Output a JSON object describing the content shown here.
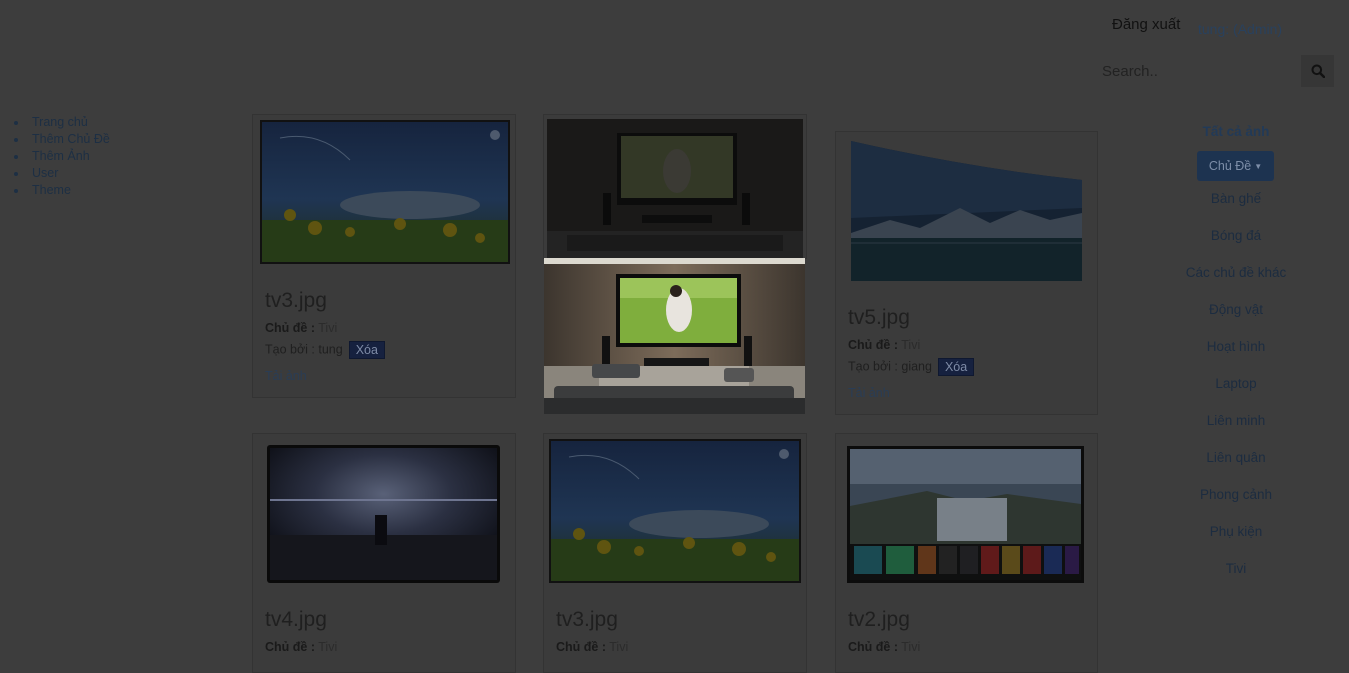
{
  "header": {
    "logout": "Đăng xuất",
    "user": "tung: (Admin)",
    "search_placeholder": "Search..",
    "search_icon": "search-icon"
  },
  "nav": {
    "items": [
      "Trang chủ",
      "Thêm Chủ Đề",
      "Thêm Ảnh",
      "User",
      "Theme"
    ]
  },
  "labels": {
    "topic": "Chủ đề :",
    "created_by": "Tạo bởi :",
    "delete": "Xóa",
    "download": "Tải ảnh"
  },
  "cards": [
    {
      "title": "tv3.jpg",
      "topic": "Tivi",
      "creator": "tung"
    },
    {
      "title": "",
      "topic": "",
      "creator": ""
    },
    {
      "title": "tv5.jpg",
      "topic": "Tivi",
      "creator": "giang"
    },
    {
      "title": "tv4.jpg",
      "topic": "Tivi"
    },
    {
      "title": "tv3.jpg",
      "topic": "Tivi"
    },
    {
      "title": "tv2.jpg",
      "topic": "Tivi"
    }
  ],
  "sidebar": {
    "all": "Tất cả ảnh",
    "dropdown": "Chủ Đề",
    "topics": [
      "Bàn ghế",
      "Bóng đá",
      "Các chủ đề khác",
      "Động vật",
      "Hoạt hình",
      "Laptop",
      "Liên minh",
      "Liên quân",
      "Phong cảnh",
      "Phụ kiện",
      "Tivi"
    ]
  },
  "colors": {
    "overlay_bg": "#3d3d3d",
    "link": "#29415d",
    "button": "#16213f"
  }
}
